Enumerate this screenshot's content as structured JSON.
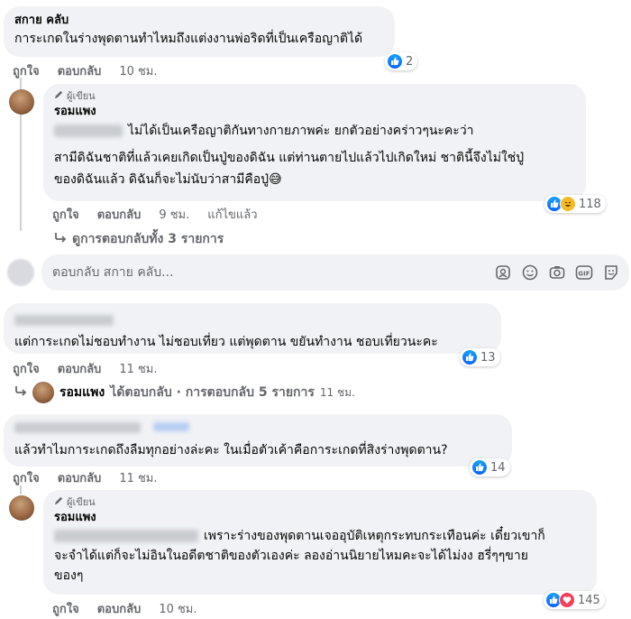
{
  "comments": [
    {
      "name": "สกาย คลับ",
      "text": "การะเกดในร่างพุดตานทำไหมถึงแต่งงานพ่อริดที่เป็นเครือญาติได้",
      "like_label": "ถูกใจ",
      "reply_label": "ตอบกลับ",
      "time": "10 ชม.",
      "reactions": "2"
    },
    {
      "badge": "ผู้เขียน",
      "name": "รอมแพง",
      "text_line1": "ไม่ได้เป็นเครือญาติกันทางกายภาพค่ะ ยกตัวอย่างคร่าวๆนะคะว่า",
      "text_line2": "สามีดิฉันชาติที่แล้วเคยเกิดเป็นปู่ของดิฉัน แต่ท่านตายไปแล้วไปเกิดใหม่ ชาตินี้จึงไม่ใช่ปู่",
      "text_line3": "ของดิฉันแล้ว ดิฉันก็จะไม่นับว่าสามีคือปู่😅",
      "like_label": "ถูกใจ",
      "reply_label": "ตอบกลับ",
      "time": "9 ชม.",
      "edited": "แก้ไขแล้ว",
      "reactions": "118",
      "view_replies": "ดูการตอบกลับทั้ง 3 รายการ"
    },
    {
      "text": "แต่การะเกดไม่ชอบทำงาน ไม่ชอบเที่ยว แต่พุดตาน ขยันทำงาน ชอบเที่ยวนะคะ",
      "like_label": "ถูกใจ",
      "reply_label": "ตอบกลับ",
      "time": "11 ชม.",
      "reactions": "13",
      "reply_summary_name": "รอมแพง",
      "reply_summary_text": "ได้ตอบกลับ · การตอบกลับ 5 รายการ",
      "reply_summary_time": "11 ชม."
    },
    {
      "text": "แล้วทำไมการะเกดถึงลืมทุกอย่างล่ะคะ ในเมื่อตัวเค้าคือการะเกดที่สิงร่างพุดตาน?",
      "like_label": "ถูกใจ",
      "reply_label": "ตอบกลับ",
      "time": "11 ชม.",
      "reactions": "14"
    },
    {
      "badge": "ผู้เขียน",
      "name": "รอมแพง",
      "text_line1": "เพราะร่างของพุดตานเจออุบัติเหตุกระทบกระเทือนค่ะ เดี๋ยวเขาก็",
      "text_line2": "จะจำได้แต่ก็จะไม่อินในอดีตชาติของตัวเองค่ะ ลองอ่านนิยายไหมคะจะได้ไม่งง ฮรี่ๆๆขาย",
      "text_line3": "ของๆ",
      "like_label": "ถูกใจ",
      "reply_label": "ตอบกลับ",
      "time": "10 ชม.",
      "reactions": "145"
    }
  ],
  "reply_input": {
    "placeholder": "ตอบกลับ สกาย คลับ..."
  },
  "icons": [
    "pencil-icon",
    "reply-arrow-icon",
    "like-reaction-icon",
    "haha-reaction-icon",
    "love-reaction-icon",
    "avatar-sticker-icon",
    "emoji-icon",
    "camera-icon",
    "gif-icon",
    "sticker-icon"
  ],
  "colors": {
    "bubble": "#f0f2f5",
    "secondary_text": "#65676b",
    "like_blue": "#0866ff",
    "love_red": "#f33e58",
    "haha_yellow": "#f7b928"
  }
}
